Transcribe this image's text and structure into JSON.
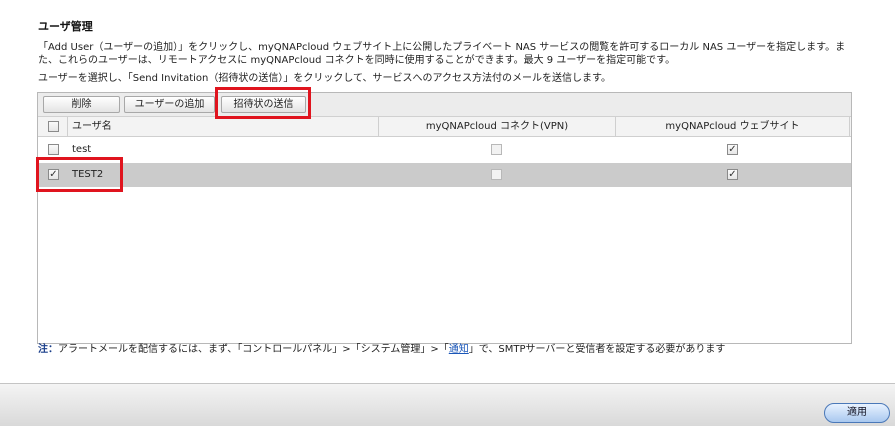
{
  "section": {
    "title": "ユーザ管理",
    "desc_line1": "「Add User（ユーザーの追加）」をクリックし、myQNAPcloud ウェブサイト上に公開したプライベート NAS サービスの閲覧を許可するローカル NAS ユーザーを指定します。ま",
    "desc_line2": "た、これらのユーザーは、リモートアクセスに myQNAPcloud コネクトを同時に使用することができます。最大 9 ユーザーを指定可能です。",
    "desc_line3": "ユーザーを選択し、「Send Invitation（招待状の送信）」をクリックして、サービスへのアクセス方法付のメールを送信します。"
  },
  "toolbar": {
    "delete_label": "削除",
    "add_user_label": "ユーザーの追加",
    "send_invitation_label": "招待状の送信"
  },
  "table": {
    "headers": {
      "user": "ユーザ名",
      "vpn": "myQNAPcloud コネクト(VPN)",
      "website": "myQNAPcloud ウェブサイト"
    },
    "rows": [
      {
        "name": "test",
        "selected": false,
        "vpn": false,
        "website": true
      },
      {
        "name": "TEST2",
        "selected": true,
        "vpn": false,
        "website": true
      }
    ]
  },
  "note": {
    "label": "注：",
    "text_before": "アラートメールを配信するには、まず、「コントロールパネル」>「システム管理」>「",
    "link": "通知",
    "text_after": "」で、SMTPサーバーと受信者を設定する必要があります"
  },
  "footer": {
    "apply_label": "適用"
  },
  "colors": {
    "highlight": "#e0141e",
    "selected_row": "#cbcbcb",
    "link": "#1a56b8"
  }
}
